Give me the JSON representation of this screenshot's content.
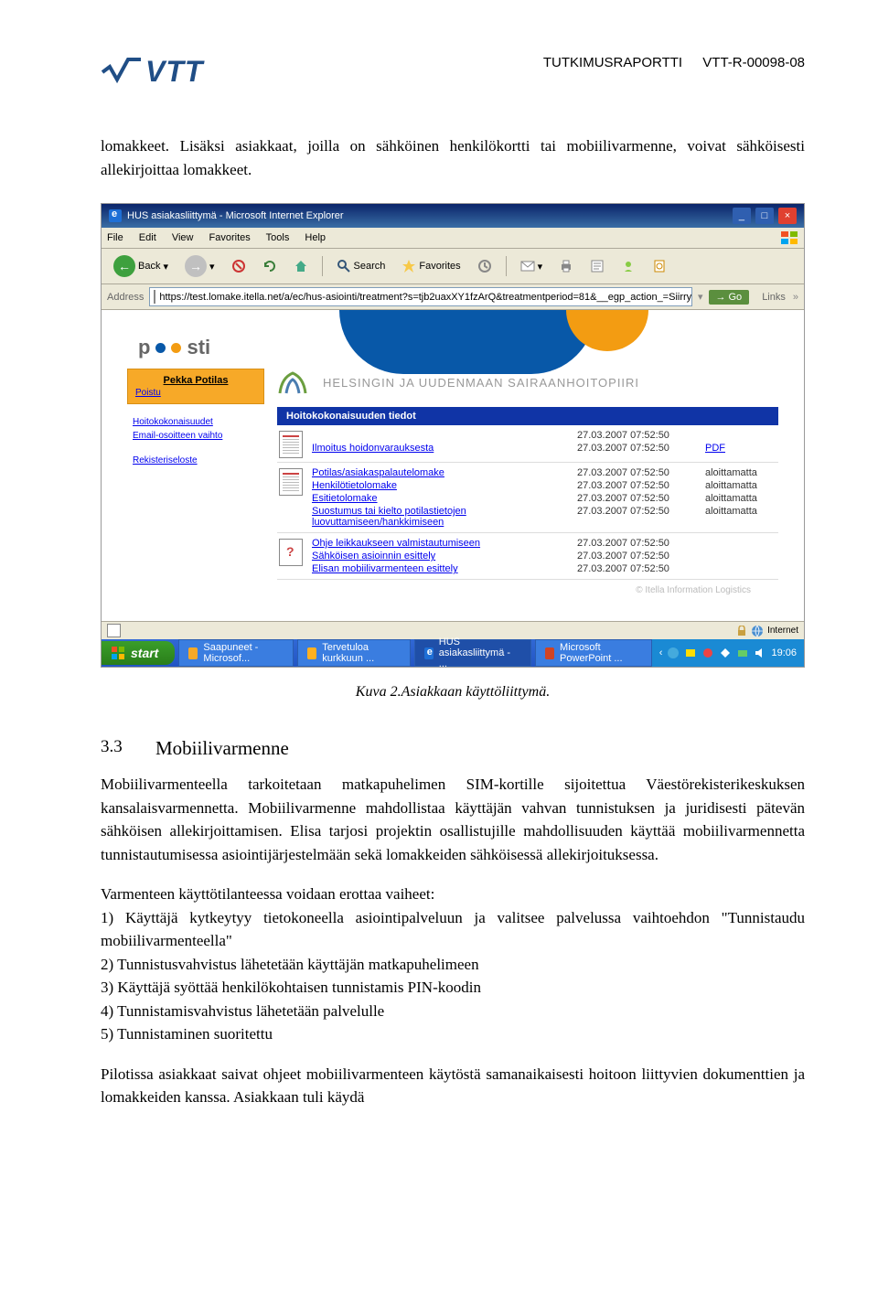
{
  "header": {
    "label": "TUTKIMUSRAPORTTI",
    "code": "VTT-R-00098-08",
    "logo": "VTT"
  },
  "intro": "lomakkeet. Lisäksi asiakkaat, joilla on sähköinen henkilökortti tai mobiilivarmenne, voivat sähköisesti allekirjoittaa lomakkeet.",
  "caption": "Kuva 2.Asiakkaan käyttöliittymä.",
  "section": {
    "num": "3.3",
    "title": "Mobiilivarmenne"
  },
  "body": [
    "Mobiilivarmenteella tarkoitetaan matkapuhelimen SIM-kortille sijoitettua Väestörekisterikeskuksen kansalaisvarmennetta. Mobiilivarmenne mahdollistaa käyttäjän vahvan tunnistuksen ja juridisesti pätevän sähköisen allekirjoittamisen. Elisa tarjosi projektin osallistujille mahdollisuuden käyttää mobiilivarmennetta tunnistautumisessa asiointijärjestelmään sekä lomakkeiden sähköisessä allekirjoituksessa.",
    "Varmenteen käyttötilanteessa voidaan erottaa vaiheet:",
    "1) Käyttäjä kytkeytyy tietokoneella asiointipalveluun ja valitsee palvelussa vaihtoehdon \"Tunnistaudu mobiilivarmenteella\"",
    "2) Tunnistusvahvistus lähetetään käyttäjän matkapuhelimeen",
    "3) Käyttäjä syöttää henkilökohtaisen tunnistamis PIN-koodin",
    "4) Tunnistamisvahvistus lähetetään palvelulle",
    "5) Tunnistaminen suoritettu",
    "Pilotissa asiakkaat saivat ohjeet mobiilivarmenteen käytöstä samanaikaisesti hoitoon liittyvien dokumenttien ja lomakkeiden kanssa. Asiakkaan tuli käydä"
  ],
  "screenshot": {
    "window_title": "HUS asiakasliittymä - Microsoft Internet Explorer",
    "menu": [
      "File",
      "Edit",
      "View",
      "Favorites",
      "Tools",
      "Help"
    ],
    "toolbar": {
      "back": "Back",
      "search": "Search",
      "favorites": "Favorites"
    },
    "address": {
      "label": "Address",
      "url": "https://test.lomake.itella.net/a/ec/hus-asiointi/treatment?s=tjb2uaxXY1fzArQ&treatmentperiod=81&__egp_action_=Siirry",
      "go": "Go",
      "links": "Links"
    },
    "posti": "p  sti",
    "user": {
      "name": "Pekka Potilas",
      "logout": "Poistu"
    },
    "sidelinks": [
      "Hoitokokonaisuudet",
      "Email-osoitteen vaihto",
      "Rekisteriseloste"
    ],
    "hus": "HELSINGIN JA UUDENMAAN SAIRAANHOITOPIIRI",
    "panel_title": "Hoitokokonaisuuden tiedot",
    "groups": [
      {
        "icon": "doc",
        "rows": [
          {
            "link": "",
            "date": "27.03.2007 07:52:50",
            "status": "",
            "pdf": ""
          },
          {
            "link": "Ilmoitus hoidonvarauksesta",
            "date": "27.03.2007 07:52:50",
            "status": "",
            "pdf": "PDF"
          }
        ]
      },
      {
        "icon": "doc",
        "rows": [
          {
            "link": "Potilas/asiakaspalautelomake",
            "date": "27.03.2007 07:52:50",
            "status": "aloittamatta",
            "pdf": ""
          },
          {
            "link": "Henkilötietolomake",
            "date": "27.03.2007 07:52:50",
            "status": "aloittamatta",
            "pdf": ""
          },
          {
            "link": "Esitietolomake",
            "date": "27.03.2007 07:52:50",
            "status": "aloittamatta",
            "pdf": ""
          },
          {
            "link": "Suostumus tai kielto potilastietojen luovuttamiseen/hankkimiseen",
            "date": "27.03.2007 07:52:50",
            "status": "aloittamatta",
            "pdf": ""
          }
        ]
      },
      {
        "icon": "q",
        "rows": [
          {
            "link": "Ohje leikkaukseen valmistautumiseen",
            "date": "27.03.2007 07:52:50",
            "status": "",
            "pdf": ""
          },
          {
            "link": "Sähköisen asioinnin esittely",
            "date": "27.03.2007 07:52:50",
            "status": "",
            "pdf": ""
          },
          {
            "link": "Elisan mobiilivarmenteen esittely",
            "date": "27.03.2007 07:52:50",
            "status": "",
            "pdf": ""
          }
        ]
      }
    ],
    "footer_note": "© Itella Information Logistics",
    "status": {
      "zone": "Internet"
    },
    "taskbar": {
      "start": "start",
      "tasks": [
        {
          "label": "Saapuneet - Microsof...",
          "app": "outlook"
        },
        {
          "label": "Tervetuloa kurkkuun ...",
          "app": "folder"
        },
        {
          "label": "HUS asiakasliittymä - ...",
          "app": "ie",
          "active": true
        },
        {
          "label": "Microsoft PowerPoint ...",
          "app": "ppt"
        }
      ],
      "clock": "19:06"
    }
  }
}
